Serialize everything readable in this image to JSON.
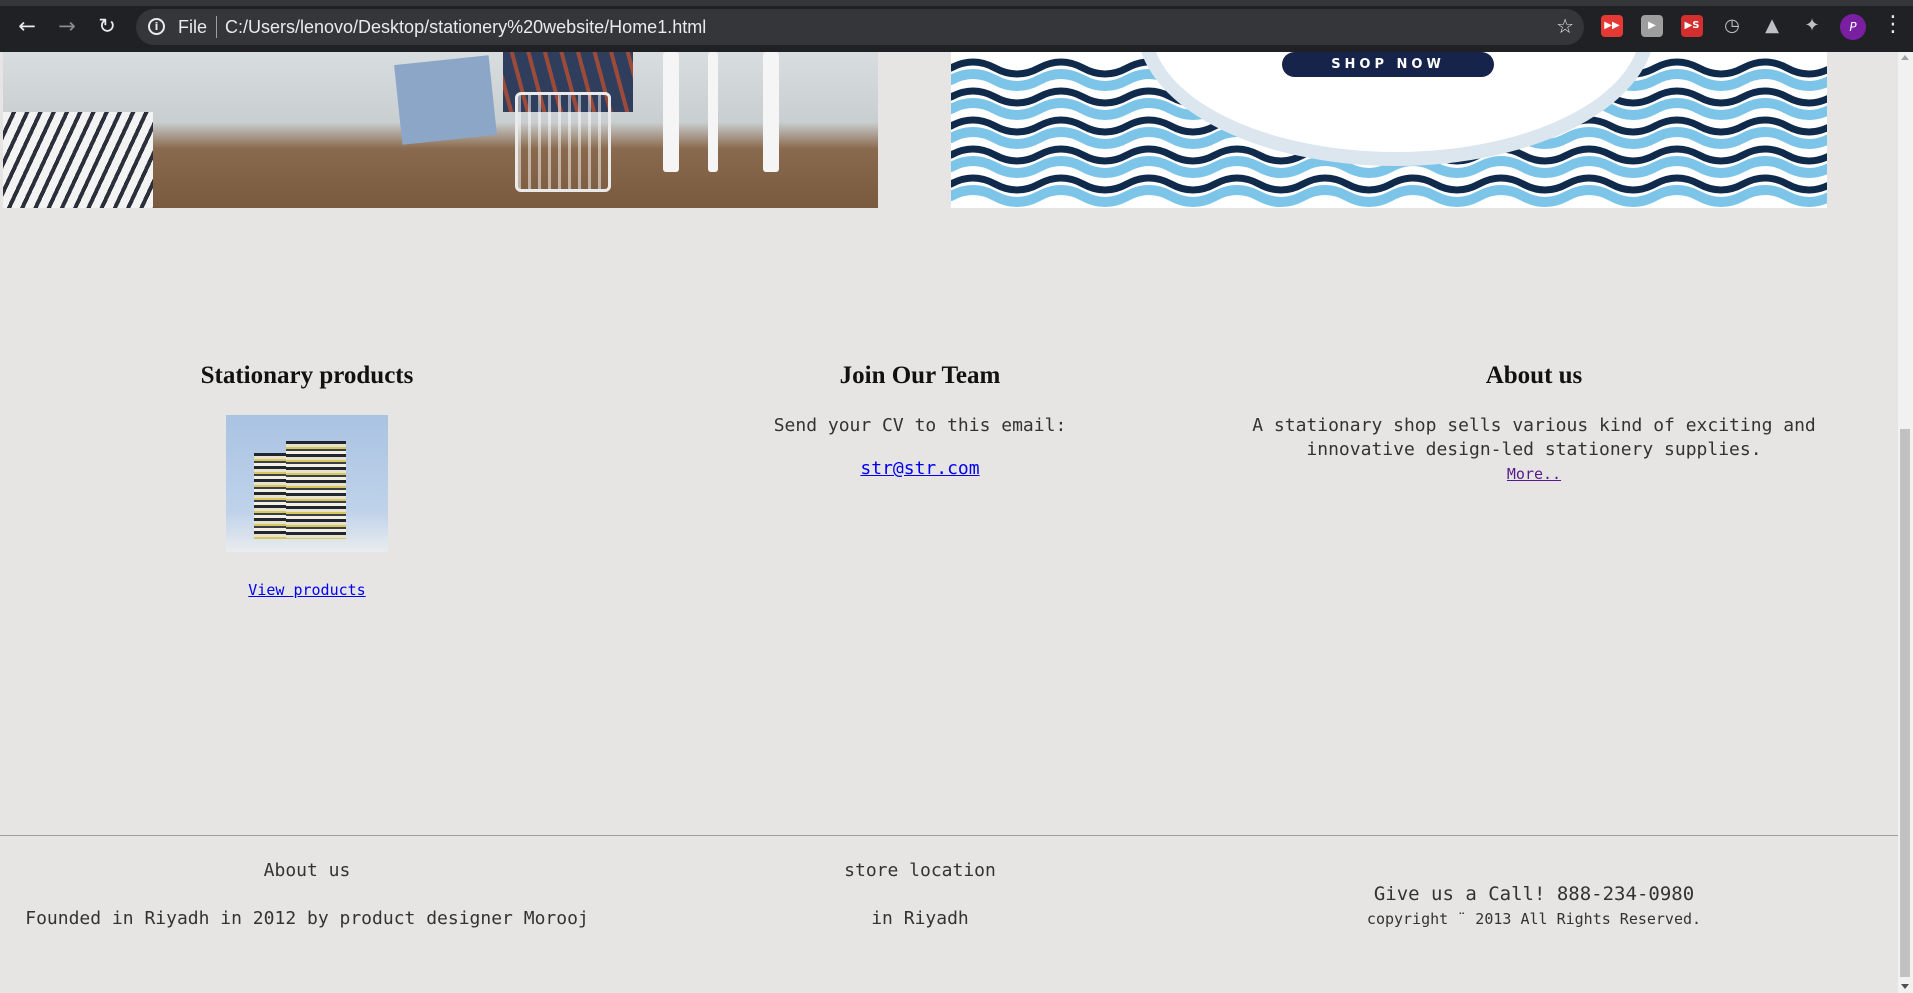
{
  "browser": {
    "scheme": "File",
    "url": "C:/Users/lenovo/Desktop/stationery%20website/Home1.html",
    "profile_initial": "P",
    "icons": [
      "back-icon",
      "forward-icon",
      "reload-icon",
      "site-info-icon",
      "bookmark-star-icon",
      "extension-youtube-icon",
      "extension-video-icon",
      "extension-s-icon",
      "extension-speed-icon",
      "extension-drive-icon",
      "extensions-puzzle-icon",
      "menu-dots-icon"
    ]
  },
  "banner": {
    "shop_now": "SHOP NOW",
    "colors": {
      "wave_light": "#7cc4e8",
      "wave_dark": "#0f2a4a",
      "button": "#16234a"
    }
  },
  "sections": {
    "products": {
      "title": "Stationary products",
      "link": "View products"
    },
    "team": {
      "title": "Join Our Team",
      "text": "Send your CV to this email:",
      "email": "str@str.com"
    },
    "about": {
      "title": "About us",
      "text_line1": "A stationary shop sells various kind of exciting and",
      "text_line2": "innovative design-led stationery supplies.",
      "more": "More.."
    }
  },
  "footer": {
    "about_heading": "About us",
    "about_text": "Founded in Riyadh in 2012 by product designer Morooj",
    "location_heading": "store location",
    "location_text": "in Riyadh",
    "call": "Give us a Call! 888-234-0980",
    "copyright": "copyright ¨ 2013 All Rights Reserved."
  },
  "colors": {
    "page_background": "#e6e5e3",
    "link": "#0000ee",
    "visited_link": "#551a8b"
  }
}
